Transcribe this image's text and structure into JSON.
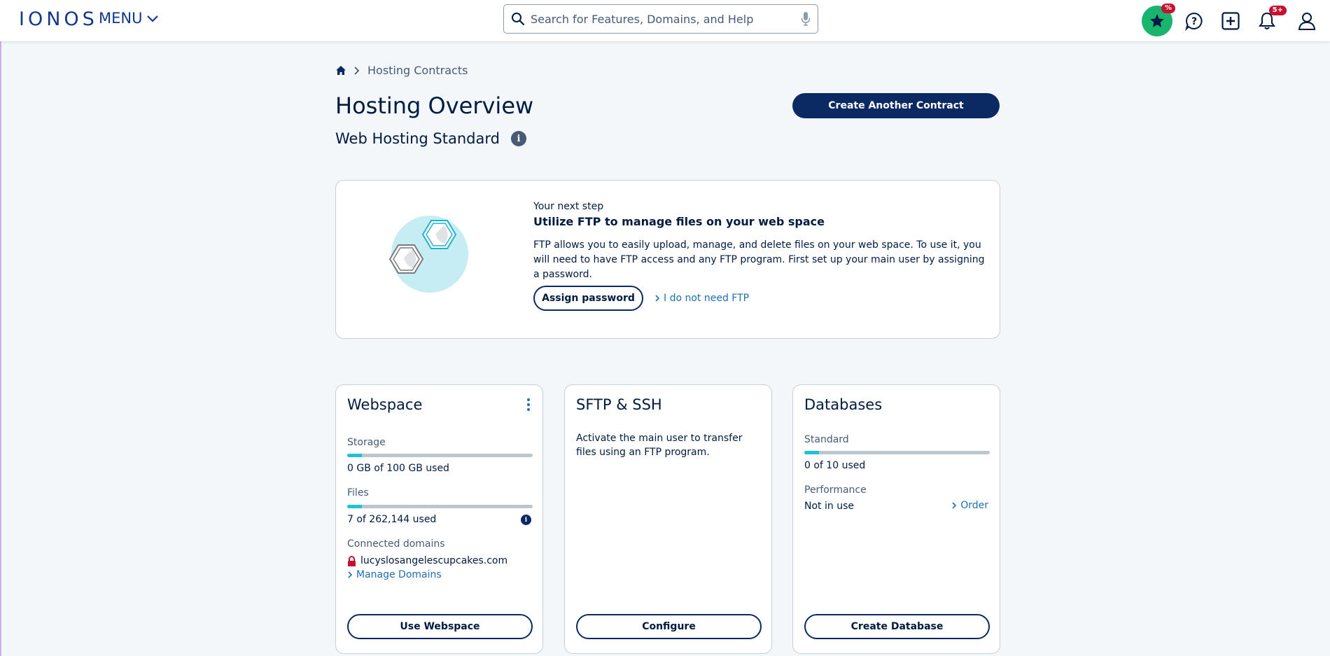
{
  "header": {
    "logo": "IONOS",
    "menu_label": "MENU",
    "search_placeholder": "Search for Features, Domains, and Help",
    "deals_badge": "%",
    "notifications_badge": "5+"
  },
  "breadcrumb": {
    "current": "Hosting Contracts"
  },
  "page": {
    "title": "Hosting Overview",
    "subtitle": "Web Hosting Standard",
    "info_glyph": "i",
    "create_button": "Create Another Contract"
  },
  "next_step": {
    "eyebrow": "Your next step",
    "title": "Utilize FTP to manage files on your web space",
    "text": "FTP allows you to easily upload, manage, and delete files on your web space. To use it, you will need to have FTP access and any FTP program. First set up your main user by assigning a password.",
    "assign_button": "Assign password",
    "skip_link": "I do not need FTP"
  },
  "webspace": {
    "title": "Webspace",
    "storage_label": "Storage",
    "storage_value": "0 GB of 100 GB used",
    "storage_fraction": 0.08,
    "files_label": "Files",
    "files_value": "7 of 262,144 used",
    "files_fraction": 0.08,
    "domains_label": "Connected domains",
    "domain": "lucyslosangelescupcakes.com",
    "manage_link": "Manage Domains",
    "button": "Use Webspace"
  },
  "sftp": {
    "title": "SFTP & SSH",
    "text": "Activate the main user to transfer files using an FTP program.",
    "button": "Configure"
  },
  "databases": {
    "title": "Databases",
    "standard_label": "Standard",
    "standard_value": "0 of 10 used",
    "standard_fraction": 0.08,
    "performance_label": "Performance",
    "performance_value": "Not in use",
    "order_link": "Order",
    "button": "Create Database"
  },
  "colors": {
    "brand": "#11388a",
    "primary_button": "#0b2a63",
    "accent_bar": "#1fc1d6",
    "deals_green": "#19b46e",
    "badge_red": "#c8102e",
    "lock_red": "#c8102e"
  },
  "icons": [
    "chevron-down-icon",
    "search-icon",
    "microphone-icon",
    "star-icon",
    "help-chat-icon",
    "plus-box-icon",
    "bell-icon",
    "user-icon",
    "home-icon",
    "chevron-right-icon",
    "info-icon",
    "kebab-icon",
    "lock-icon"
  ]
}
